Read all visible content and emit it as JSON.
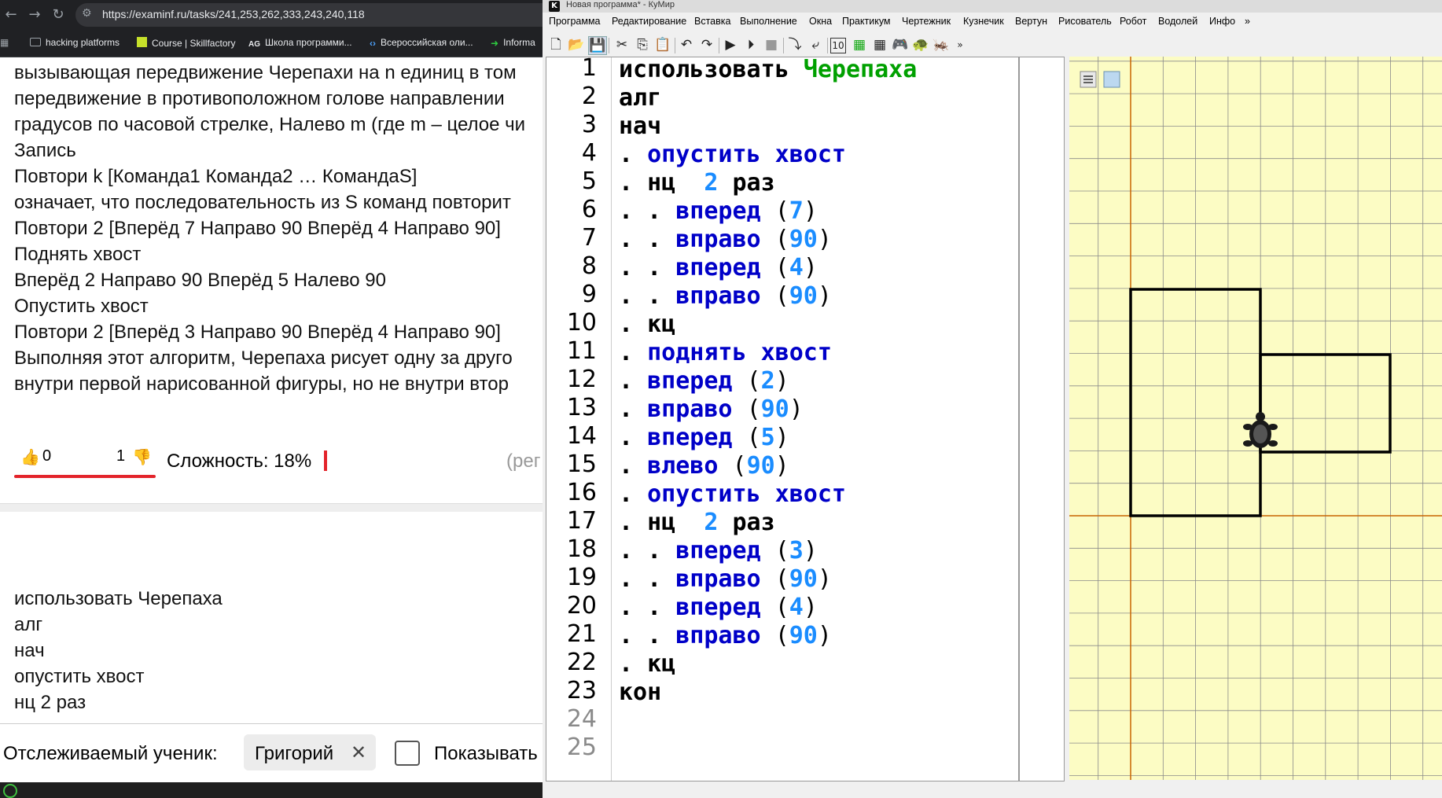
{
  "browser": {
    "url": "https://examinf.ru/tasks/241,253,262,333,243,240,118",
    "bookmarks": [
      {
        "label": "hacking platforms"
      },
      {
        "label": "Course | Skillfactory"
      },
      {
        "label": "Школа программи..."
      },
      {
        "label": "Всероссийская оли..."
      },
      {
        "label": "Informa"
      }
    ],
    "task_lines": [
      "вызывающая передвижение Черепахи на n единиц в том",
      "передвижение в противоположном голове направлении",
      "градусов по часовой стрелке, Налево m (где m – целое чи",
      "Запись",
      "Повтори k [Команда1 Команда2 … КомандаS]",
      "означает, что последовательность из S команд повторит",
      "Повтори 2 [Вперёд 7 Направо 90 Вперёд 4 Направо 90]",
      "Поднять хвост",
      "Вперёд 2 Направо 90 Вперёд 5 Налево 90",
      "Опустить хвост",
      "Повтори 2 [Вперёд 3 Направо 90 Вперёд 4 Направо 90]",
      "Выполняя этот алгоритм, Черепаха рисует одну за друго",
      "внутри первой нарисованной фигуры, но не внутри втор"
    ],
    "likes": "0",
    "dislikes": "1",
    "difficulty": "Сложность: 18%",
    "difficulty_tail": "(рег",
    "solution_lines": [
      "использовать Черепаха",
      "алг",
      "нач",
      "опустить хвост",
      "нц  2 раз"
    ],
    "student_label": "Отслеживаемый ученик:",
    "student_name": "Григорий",
    "show_label": "Показывать"
  },
  "kumir": {
    "title": "Новая программа* - КуМир",
    "menu": [
      "Программа",
      "Редактирование",
      "Вставка",
      "Выполнение",
      "Окна",
      "Практикум",
      "Чертежник",
      "Кузнечик",
      "Вертун",
      "Рисователь",
      "Робот",
      "Водолей",
      "Инфо"
    ],
    "menu_more": "»",
    "line_numbers": [
      "1",
      "2",
      "3",
      "4",
      "5",
      "6",
      "7",
      "8",
      "9",
      "10",
      "11",
      "12",
      "13",
      "14",
      "15",
      "16",
      "17",
      "18",
      "19",
      "20",
      "21",
      "22",
      "23",
      "24",
      "25"
    ],
    "program": {
      "l1_kw": "использовать",
      "l1_actor": "Черепаха",
      "l2": "алг",
      "l3": "нач",
      "l4": "опустить хвост",
      "l5_kw": "нц",
      "l5_num": "2",
      "l5_kw2": "раз",
      "l6_cmd": "вперед",
      "l6_arg": "7",
      "l7_cmd": "вправо",
      "l7_arg": "90",
      "l8_cmd": "вперед",
      "l8_arg": "4",
      "l9_cmd": "вправо",
      "l9_arg": "90",
      "l10": "кц",
      "l11": "поднять хвост",
      "l12_cmd": "вперед",
      "l12_arg": "2",
      "l13_cmd": "вправо",
      "l13_arg": "90",
      "l14_cmd": "вперед",
      "l14_arg": "5",
      "l15_cmd": "влево",
      "l15_arg": "90",
      "l16": "опустить хвост",
      "l17_kw": "нц",
      "l17_num": "2",
      "l17_kw2": "раз",
      "l18_cmd": "вперед",
      "l18_arg": "3",
      "l19_cmd": "вправо",
      "l19_arg": "90",
      "l20_cmd": "вперед",
      "l20_arg": "4",
      "l21_cmd": "вправо",
      "l21_arg": "90",
      "l22": "кц",
      "l23": "кон"
    },
    "colors": {
      "canvas_bg": "#fcfcc4",
      "grid": "#8a8a8a",
      "axis": "#c86400",
      "keyword": "#000000",
      "command": "#0000c8",
      "number": "#1a8cff",
      "actor": "#00a000"
    },
    "turtle_canvas": {
      "figures": [
        {
          "name": "rectangle-1",
          "width_units": 4,
          "height_units": 7
        },
        {
          "name": "rectangle-2",
          "width_units": 4,
          "height_units": 3
        }
      ]
    }
  }
}
